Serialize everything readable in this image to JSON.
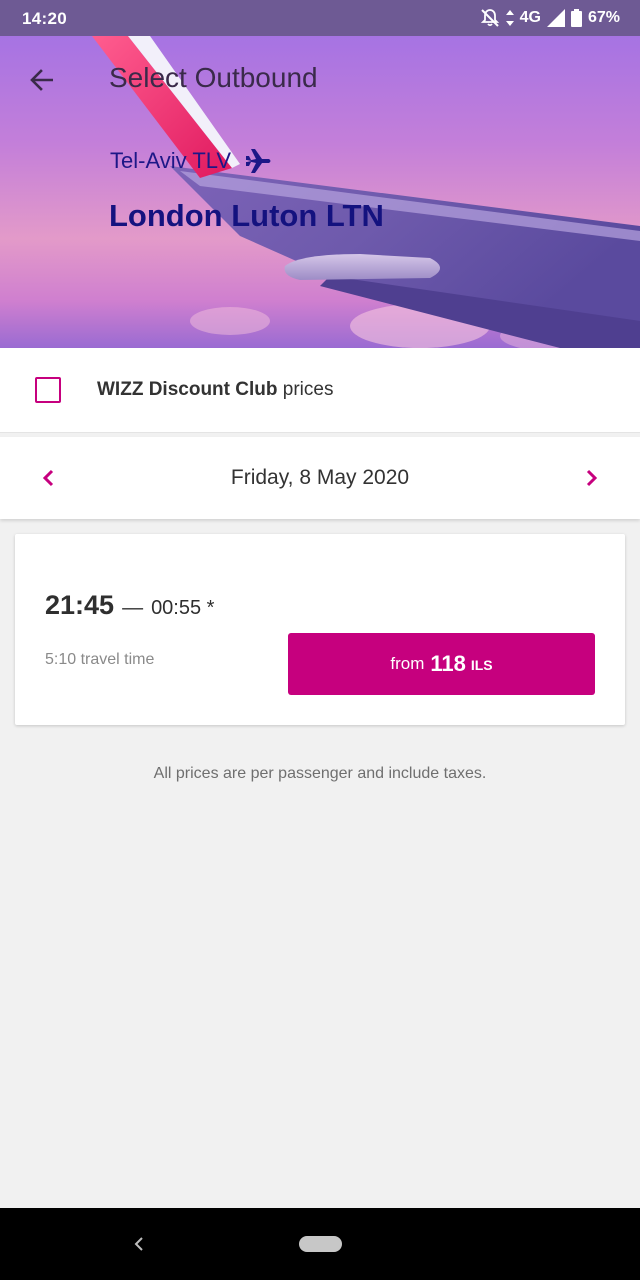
{
  "status_bar": {
    "time": "14:20",
    "network": "4G",
    "battery": "67%"
  },
  "header": {
    "title": "Select Outbound",
    "origin": "Tel-Aviv TLV",
    "destination": "London Luton LTN",
    "icons": [
      "back-arrow-icon",
      "airplane-icon"
    ]
  },
  "discount": {
    "brand": "WIZZ Discount Club",
    "suffix": "prices",
    "checked": false
  },
  "date_nav": {
    "date": "Friday, 8 May 2020"
  },
  "flight": {
    "departure": "21:45",
    "separator": "—",
    "arrival": "00:55 *",
    "duration": "5:10 travel time",
    "price_prefix": "from",
    "price": "118",
    "currency": "ILS"
  },
  "footnote": "All prices are per passenger and include taxes.",
  "colors": {
    "accent": "#c6007e",
    "navy": "#14127f",
    "status_bar": "#6e5a94"
  }
}
